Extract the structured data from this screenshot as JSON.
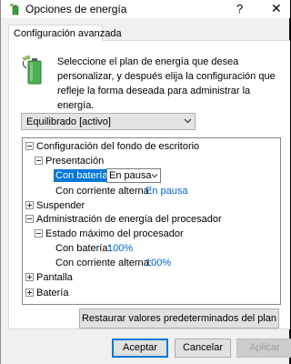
{
  "window": {
    "title": "Opciones de energía",
    "help_glyph": "?",
    "close_glyph": "✕",
    "icon": "power-options-icon"
  },
  "tab": {
    "label": "Configuración avanzada"
  },
  "intro": {
    "icon": "battery-plug-icon",
    "text": "Seleccione el plan de energía que desea personalizar, y después elija la configuración que refleje la forma deseada para administrar la energía."
  },
  "plan_select": {
    "value": "Equilibrado [activo]"
  },
  "tree": {
    "desktop_bg": {
      "label": "Configuración del fondo de escritorio"
    },
    "presentation": {
      "label": "Presentación"
    },
    "on_battery": {
      "label": "Con batería:",
      "value": "En pausa"
    },
    "plugged_in": {
      "label": "Con corriente alterna:",
      "value": "En pausa"
    },
    "suspend": {
      "label": "Suspender"
    },
    "cpu": {
      "label": "Administración de energía del procesador"
    },
    "cpu_max": {
      "label": "Estado máximo del procesador"
    },
    "cpu_battery": {
      "label": "Con batería:",
      "value": "100%"
    },
    "cpu_plugged": {
      "label": "Con corriente alterna:",
      "value": "100%"
    },
    "display": {
      "label": "Pantalla"
    },
    "battery": {
      "label": "Batería"
    }
  },
  "buttons": {
    "restore": "Restaurar valores predeterminados del plan",
    "accept": "Aceptar",
    "cancel": "Cancelar",
    "apply": "Aplicar"
  },
  "colors": {
    "selection": "#0078d7",
    "value_link": "#0066cc"
  }
}
